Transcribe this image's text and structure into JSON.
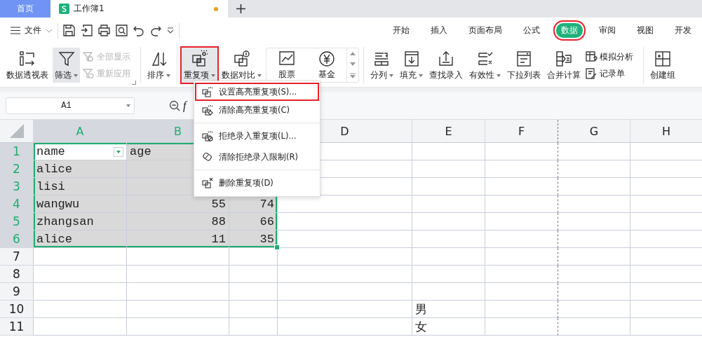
{
  "doc_tabs": [
    {
      "label": "首页",
      "kind": "home",
      "selected": false
    },
    {
      "label": "工作簿1",
      "kind": "workbook",
      "selected": true,
      "modified": true
    }
  ],
  "menu_bar": {
    "file_menu": "文件"
  },
  "ribbon_tabs": [
    {
      "label": "开始",
      "selected": false,
      "outlined": false
    },
    {
      "label": "插入",
      "selected": false,
      "outlined": false
    },
    {
      "label": "页面布局",
      "selected": false,
      "outlined": false
    },
    {
      "label": "公式",
      "selected": false,
      "outlined": false
    },
    {
      "label": "数据",
      "selected": true,
      "outlined": true
    },
    {
      "label": "审阅",
      "selected": false,
      "outlined": false
    },
    {
      "label": "视图",
      "selected": false,
      "outlined": false
    },
    {
      "label": "开发",
      "selected": false,
      "outlined": false
    }
  ],
  "ribbon": [
    {
      "kind": "large",
      "label": "数据透视表",
      "dropdown": false,
      "selected": false,
      "outlined": false
    },
    {
      "kind": "large",
      "label": "筛选",
      "dropdown": true,
      "selected": true,
      "outlined": false
    },
    {
      "kind": "small",
      "dialog_launcher": true,
      "items": [
        {
          "label": "全部显示",
          "disabled": true
        },
        {
          "label": "重新应用",
          "disabled": true
        }
      ]
    },
    {
      "kind": "separator"
    },
    {
      "kind": "large",
      "label": "排序",
      "dropdown": true,
      "selected": false,
      "outlined": false
    },
    {
      "kind": "separator"
    },
    {
      "kind": "large",
      "label": "重复项",
      "dropdown": true,
      "selected": true,
      "outlined": true
    },
    {
      "kind": "large",
      "label": "数据对比",
      "dropdown": true,
      "selected": false,
      "outlined": false
    },
    {
      "kind": "gallery",
      "items": [
        {
          "label": "股票"
        },
        {
          "label": "基金"
        }
      ]
    },
    {
      "kind": "separator"
    },
    {
      "kind": "large",
      "label": "分列",
      "dropdown": true,
      "selected": false,
      "outlined": false
    },
    {
      "kind": "large",
      "label": "填充",
      "dropdown": true,
      "selected": false,
      "outlined": false
    },
    {
      "kind": "large",
      "label": "查找录入",
      "dropdown": false,
      "selected": false,
      "outlined": false
    },
    {
      "kind": "large",
      "label": "有效性",
      "dropdown": true,
      "selected": false,
      "outlined": false
    },
    {
      "kind": "large",
      "label": "下拉列表",
      "dropdown": false,
      "selected": false,
      "outlined": false
    },
    {
      "kind": "large",
      "label": "合并计算",
      "dropdown": false,
      "selected": false,
      "outlined": false
    },
    {
      "kind": "small",
      "dialog_launcher": false,
      "items": [
        {
          "label": "模拟分析",
          "disabled": false
        },
        {
          "label": "记录单",
          "disabled": false
        }
      ]
    },
    {
      "kind": "separator"
    },
    {
      "kind": "large",
      "label": "创建组",
      "dropdown": false,
      "selected": false,
      "outlined": false
    }
  ],
  "formula_bar": {
    "name_box": "A1",
    "fx_label": "f"
  },
  "dropdown_menu": [
    {
      "kind": "item",
      "label": "设置高亮重复项(S)...",
      "outlined": true
    },
    {
      "kind": "item",
      "label": "清除高亮重复项(C)",
      "outlined": false
    },
    {
      "kind": "separator"
    },
    {
      "kind": "item",
      "label": "拒绝录入重复项(L)...",
      "outlined": false
    },
    {
      "kind": "item",
      "label": "清除拒绝录入限制(R)",
      "outlined": false
    },
    {
      "kind": "separator"
    },
    {
      "kind": "item",
      "label": "删除重复项(D)",
      "outlined": false
    }
  ],
  "sheet": {
    "autofilter": true,
    "columns": [
      {
        "label": "A",
        "selected": true
      },
      {
        "label": "B",
        "selected": true
      },
      {
        "selected": true
      },
      {
        "label": "D",
        "selected": false
      },
      {
        "label": "E",
        "selected": false
      },
      {
        "label": "F",
        "selected": false
      },
      {
        "label": "G",
        "selected": false,
        "page_break": true
      },
      {
        "label": "H",
        "selected": false
      }
    ],
    "rows": [
      {
        "label": "1",
        "selected": true,
        "cells": [
          "name",
          "age"
        ]
      },
      {
        "label": "2",
        "selected": true,
        "cells": [
          "alice"
        ]
      },
      {
        "label": "3",
        "selected": true,
        "cells": [
          "lisi"
        ]
      },
      {
        "label": "4",
        "selected": true,
        "cells": [
          "wangwu",
          "55",
          "74"
        ]
      },
      {
        "label": "5",
        "selected": true,
        "cells": [
          "zhangsan",
          "88",
          "66"
        ]
      },
      {
        "label": "6",
        "selected": true,
        "cells": [
          "alice",
          "11",
          "35"
        ]
      },
      {
        "label": "7",
        "selected": false,
        "cells": []
      },
      {
        "label": "8",
        "selected": false,
        "cells": []
      },
      {
        "label": "9",
        "selected": false,
        "cells": []
      },
      {
        "label": "10",
        "selected": false,
        "cells": [
          null,
          null,
          null,
          null,
          "男"
        ]
      },
      {
        "label": "11",
        "selected": false,
        "cells": [
          null,
          null,
          null,
          null,
          "女"
        ]
      }
    ]
  }
}
